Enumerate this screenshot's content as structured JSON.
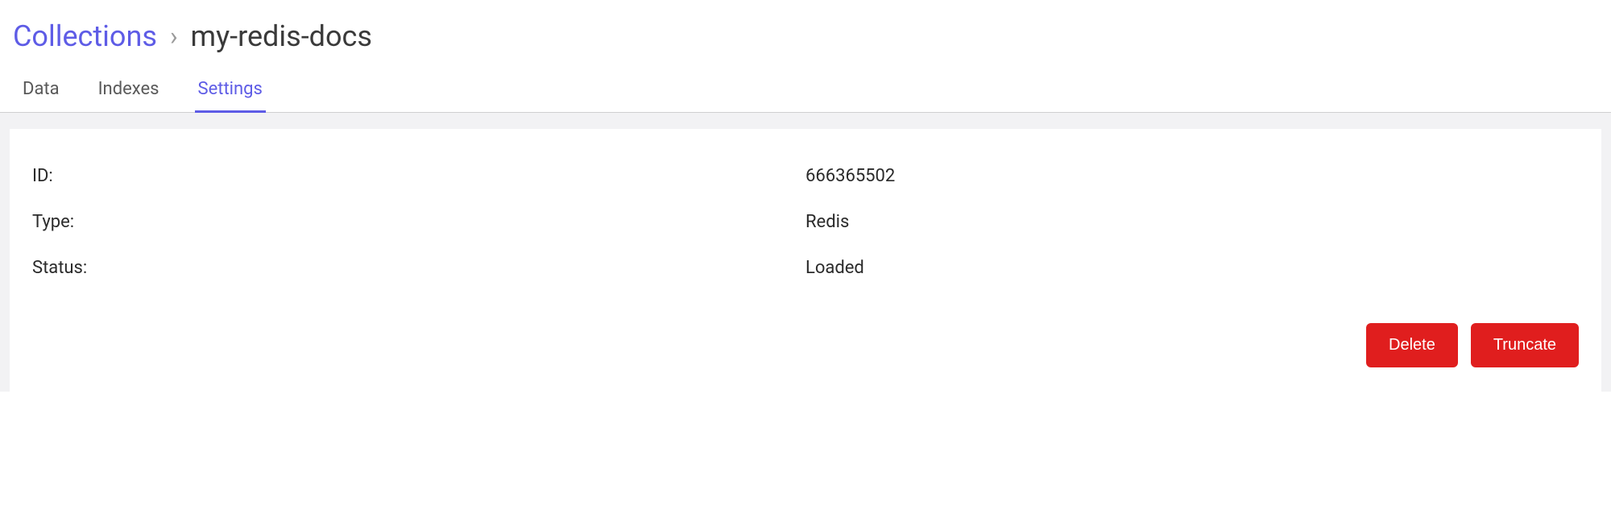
{
  "breadcrumb": {
    "root": "Collections",
    "separator": "›",
    "current": "my-redis-docs"
  },
  "tabs": {
    "data": "Data",
    "indexes": "Indexes",
    "settings": "Settings"
  },
  "fields": {
    "id_label": "ID:",
    "id_value": "666365502",
    "type_label": "Type:",
    "type_value": "Redis",
    "status_label": "Status:",
    "status_value": "Loaded"
  },
  "actions": {
    "delete": "Delete",
    "truncate": "Truncate"
  }
}
